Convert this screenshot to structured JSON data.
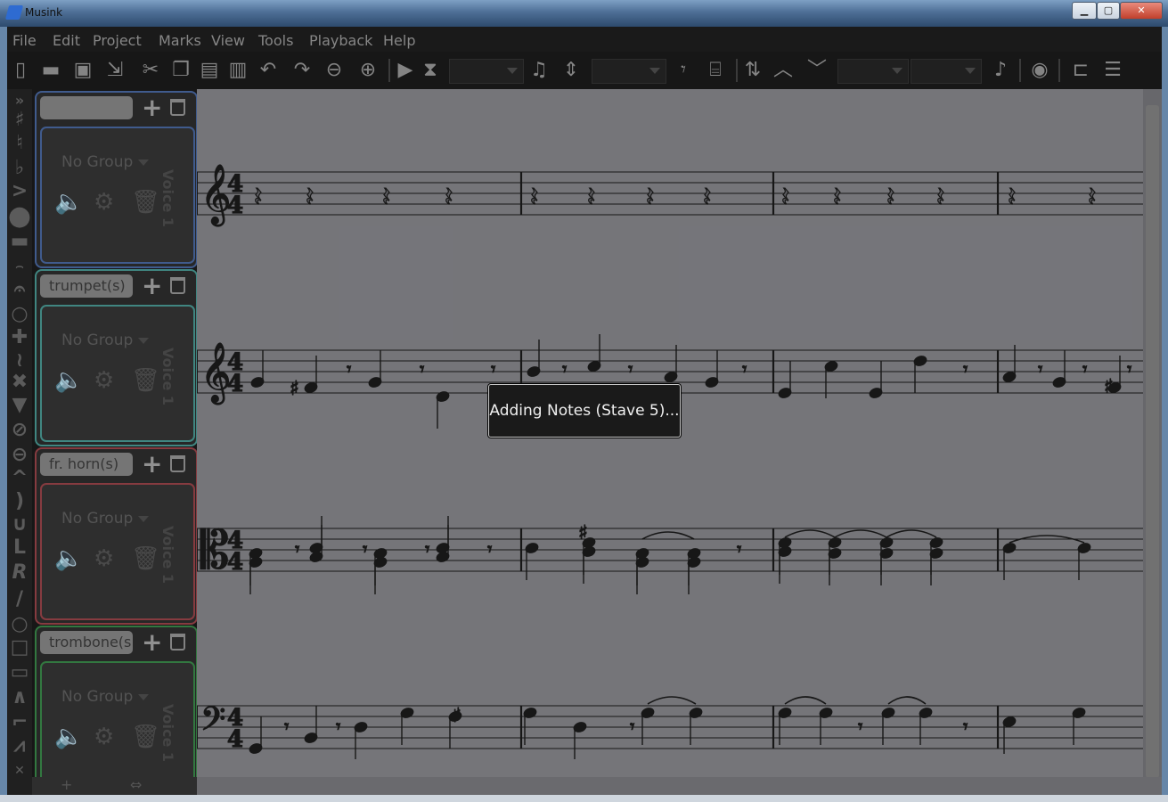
{
  "window": {
    "title": "Musink",
    "min_label": "▁",
    "max_label": "▢",
    "close_label": "✕"
  },
  "menu": [
    "File",
    "Edit",
    "Project",
    "Marks",
    "View",
    "Tools",
    "Playback",
    "Help"
  ],
  "staves": [
    {
      "name": "",
      "group": "No Group",
      "voice": "Voice 1",
      "color": "#3f5e97"
    },
    {
      "name": "trumpet(s)",
      "group": "No Group",
      "voice": "Voice 1",
      "color": "#3f8f89"
    },
    {
      "name": "fr. horn(s)",
      "group": "No Group",
      "voice": "Voice 1",
      "color": "#8f3a3f"
    },
    {
      "name": "trombone(s",
      "group": "No Group",
      "voice": "Voice 1",
      "color": "#2f7f3f"
    }
  ],
  "time_signature": [
    "4",
    "4"
  ],
  "status_popup": "Adding Notes (Stave 5)...",
  "colors": {
    "score_bg": "#7c7c80",
    "ink": "#111111",
    "rest_grey": "#5e5e62"
  }
}
